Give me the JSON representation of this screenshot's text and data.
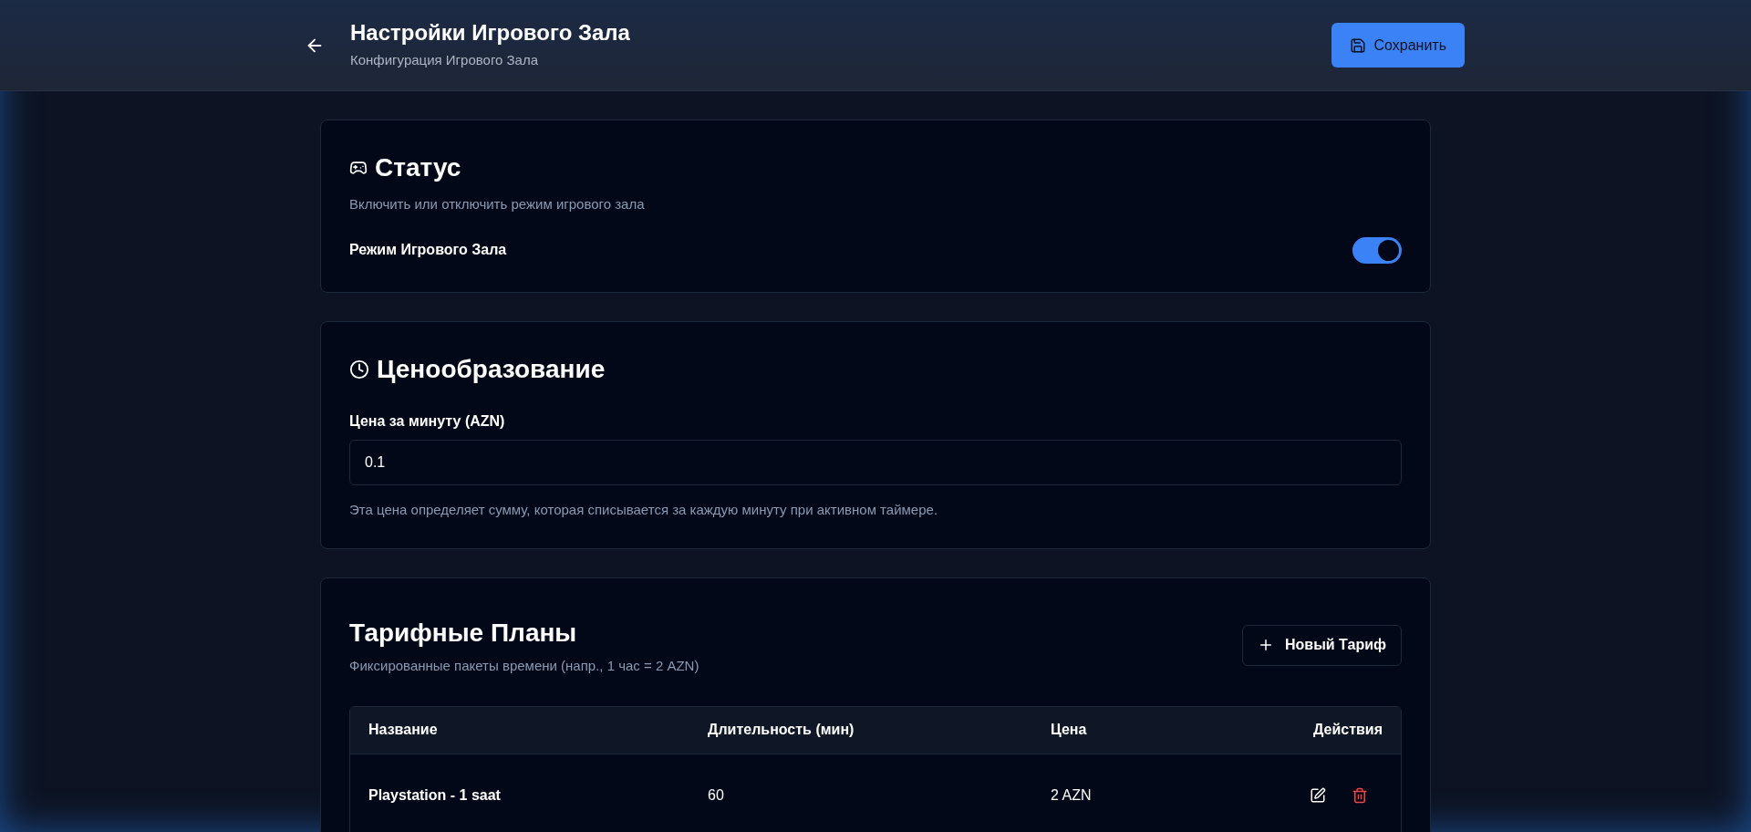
{
  "header": {
    "title": "Настройки Игрового Зала",
    "subtitle": "Конфигурация Игрового Зала",
    "save_button": "Сохранить"
  },
  "status_card": {
    "title": "Статус",
    "description": "Включить или отключить режим игрового зала",
    "toggle_label": "Режим Игрового Зала",
    "on": true
  },
  "pricing_card": {
    "title": "Ценообразование",
    "field_label": "Цена за минуту (AZN)",
    "value": "0.1",
    "hint": "Эта цена определяет сумму, которая списывается за каждую минуту при активном таймере."
  },
  "plans_card": {
    "title": "Тарифные Планы",
    "subtitle": "Фиксированные пакеты времени (напр., 1 час = 2 AZN)",
    "new_button": "Новый Тариф",
    "table": {
      "columns": [
        "Название",
        "Длительность (мин)",
        "Цена",
        "Действия"
      ],
      "rows": [
        {
          "name": "Playstation - 1 saat",
          "duration": "60",
          "price": "2 AZN"
        }
      ]
    }
  }
}
